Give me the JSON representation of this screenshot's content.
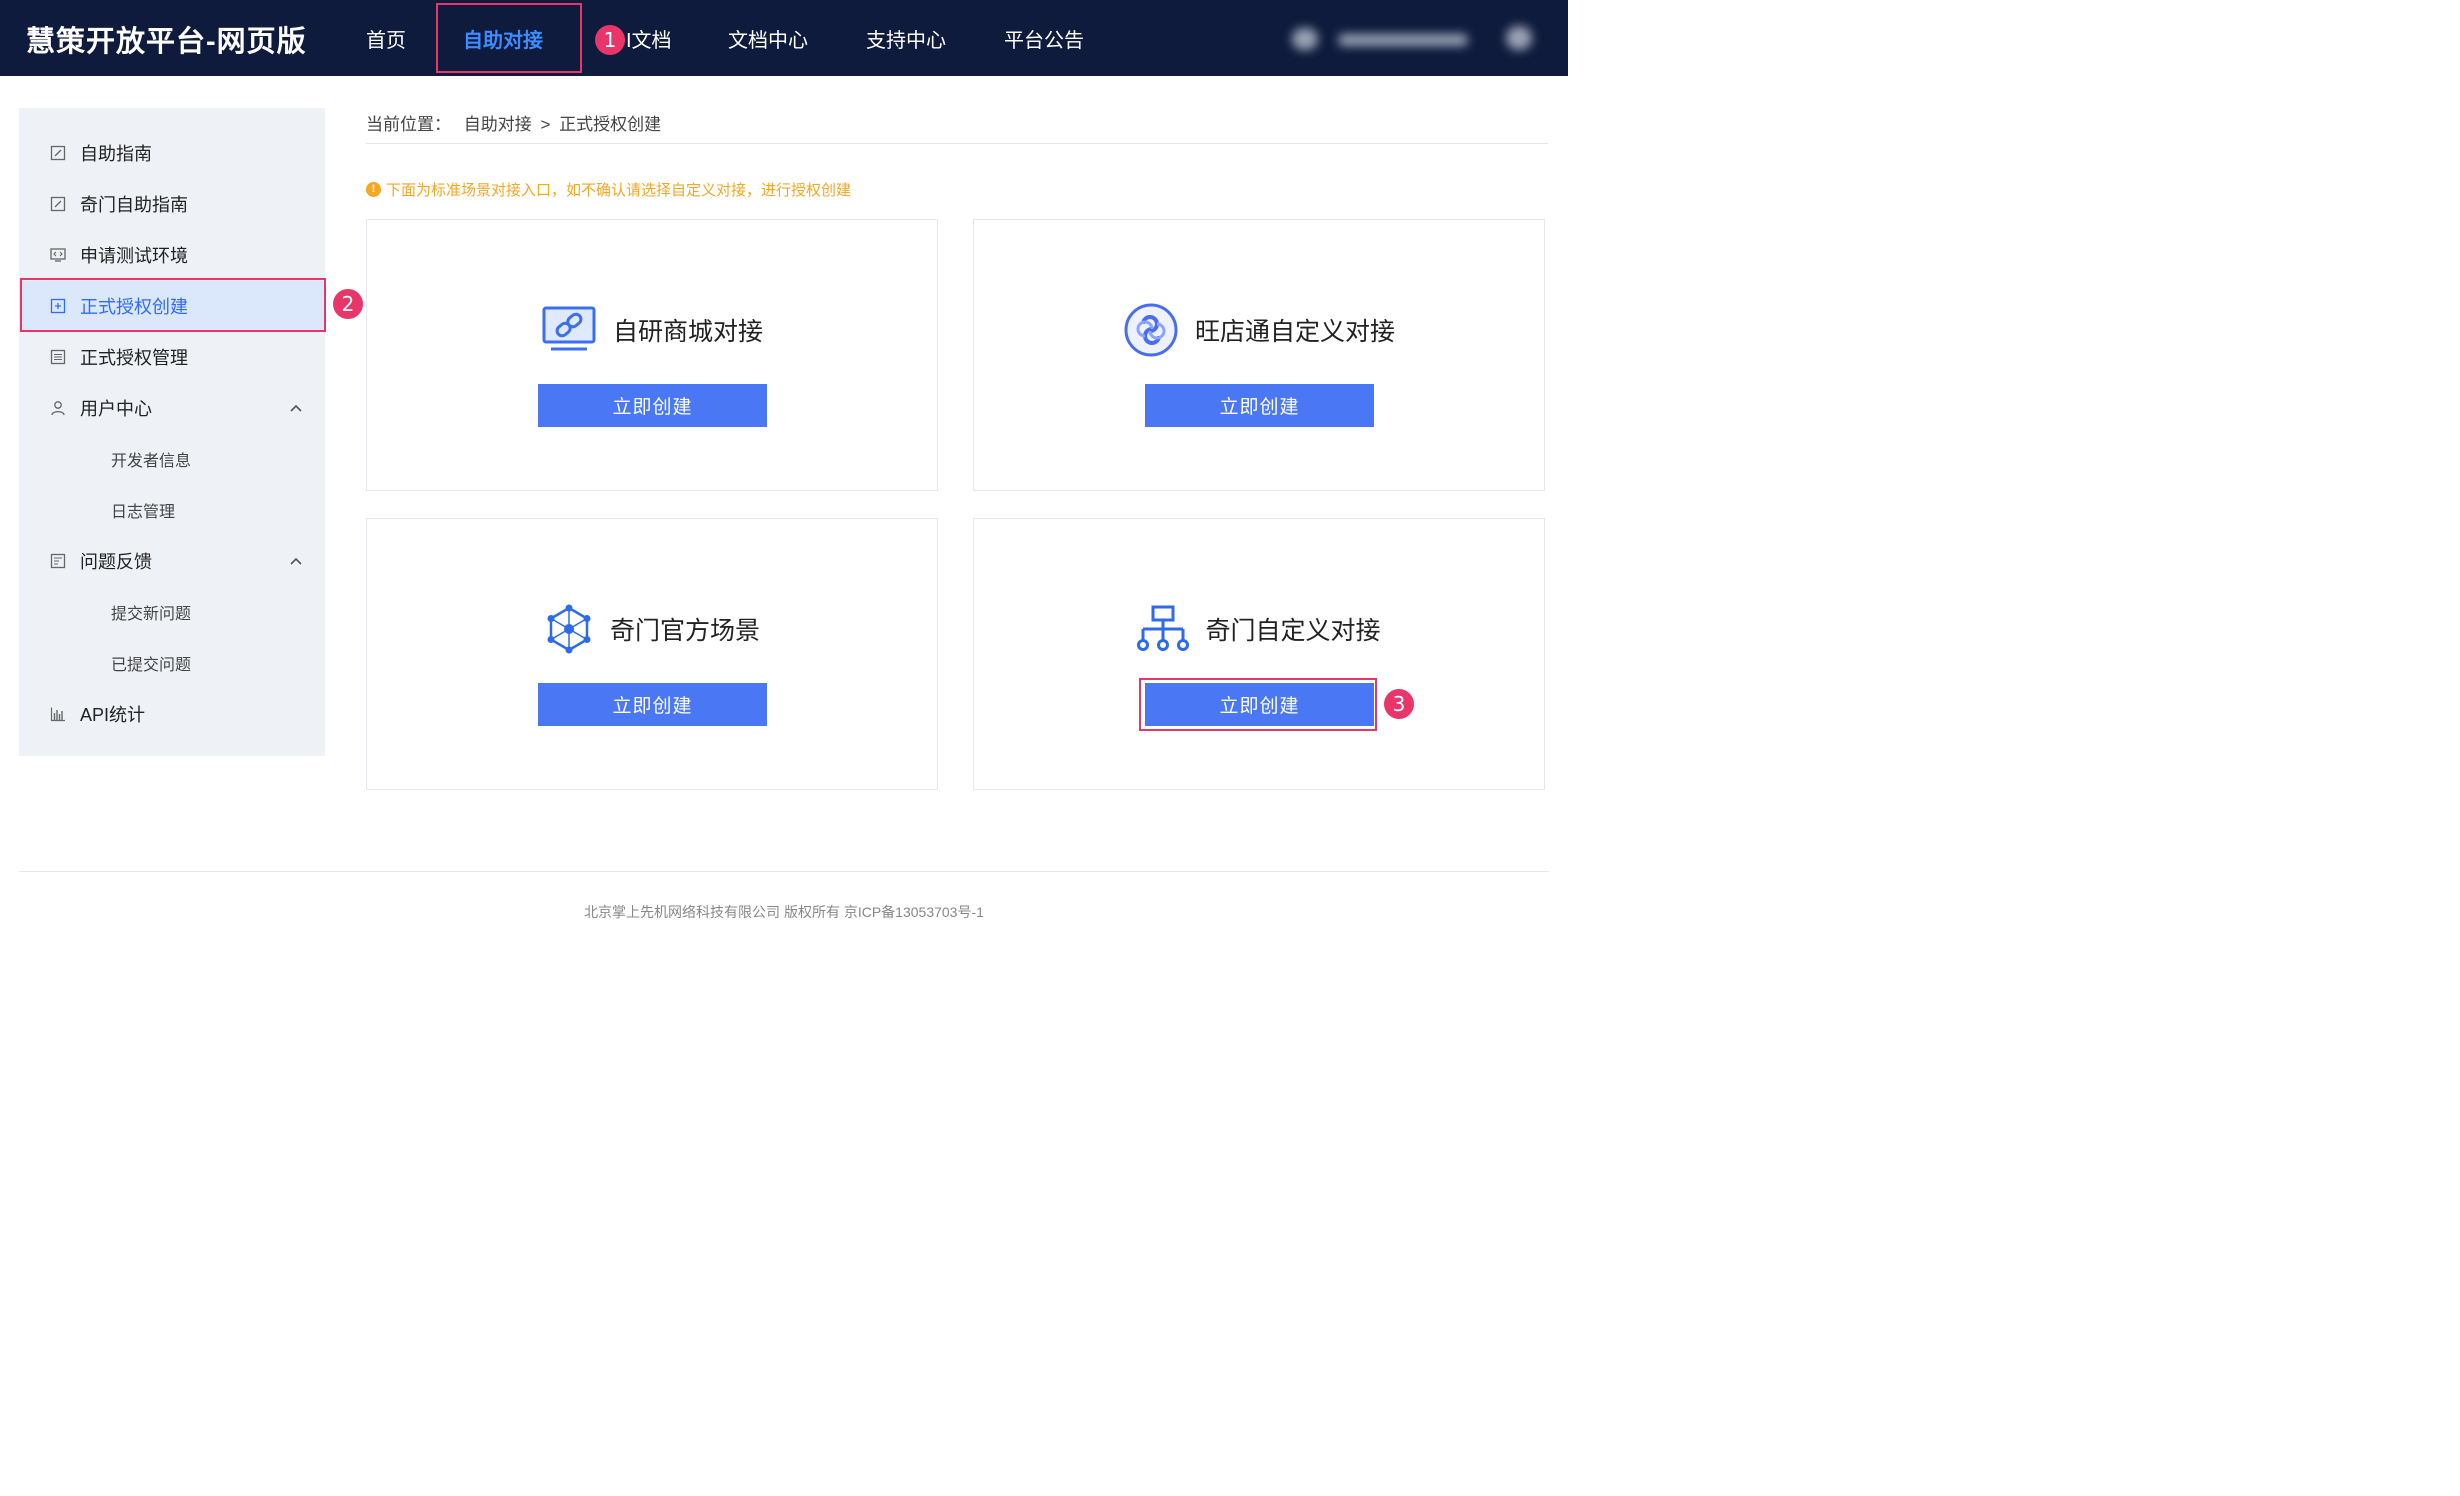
{
  "header": {
    "brand": "慧策开放平台-网页版",
    "nav": [
      {
        "label": "首页"
      },
      {
        "label": "自助对接"
      },
      {
        "label": "I文档"
      },
      {
        "label": "文档中心"
      },
      {
        "label": "支持中心"
      },
      {
        "label": "平台公告"
      }
    ]
  },
  "markers": {
    "m1": "1",
    "m2": "2",
    "m3": "3"
  },
  "sidebar": {
    "items": [
      {
        "label": "自助指南",
        "icon": "edit-doc-icon"
      },
      {
        "label": "奇门自助指南",
        "icon": "edit-doc-icon"
      },
      {
        "label": "申请测试环境",
        "icon": "code-monitor-icon"
      },
      {
        "label": "正式授权创建",
        "icon": "add-box-icon"
      },
      {
        "label": "正式授权管理",
        "icon": "list-box-icon"
      },
      {
        "label": "用户中心",
        "icon": "user-icon"
      },
      {
        "label": "开发者信息"
      },
      {
        "label": "日志管理"
      },
      {
        "label": "问题反馈",
        "icon": "feedback-icon"
      },
      {
        "label": "提交新问题"
      },
      {
        "label": "已提交问题"
      },
      {
        "label": "API统计",
        "icon": "bar-chart-icon"
      }
    ]
  },
  "breadcrumb": {
    "prefix": "当前位置：",
    "parent": "自助对接",
    "separator": ">",
    "current": "正式授权创建"
  },
  "notice": "下面为标准场景对接入口，如不确认请选择自定义对接，进行授权创建",
  "cards": [
    {
      "title": "自研商城对接",
      "button": "立即创建",
      "icon": "link-monitor-icon"
    },
    {
      "title": "旺店通自定义对接",
      "button": "立即创建",
      "icon": "wdt-logo-icon"
    },
    {
      "title": "奇门官方场景",
      "button": "立即创建",
      "icon": "network-hex-icon"
    },
    {
      "title": "奇门自定义对接",
      "button": "立即创建",
      "icon": "org-chart-icon"
    }
  ],
  "footer": "北京掌上先机网络科技有限公司 版权所有 京ICP备13053703号-1",
  "colors": {
    "header_bg": "#0e1b3c",
    "accent": "#4a78f5",
    "highlight": "#e8366b",
    "notice": "#f5a623",
    "sidebar_bg": "#eef1f6"
  }
}
